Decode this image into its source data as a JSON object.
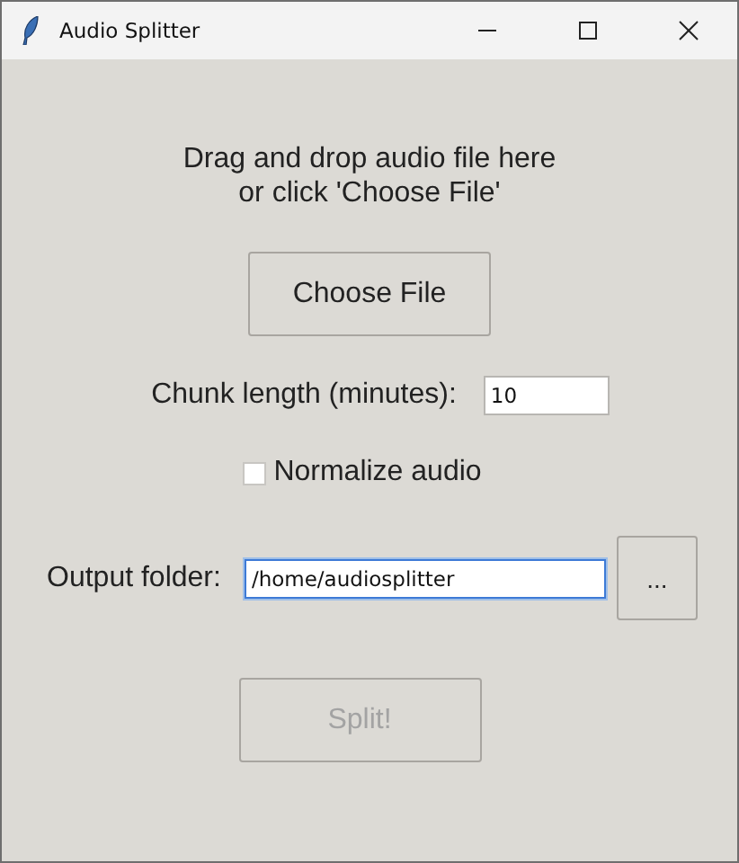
{
  "window": {
    "title": "Audio Splitter"
  },
  "instructions": [
    "Drag and drop audio file here",
    "or click 'Choose File'"
  ],
  "choose_button": {
    "label": "Choose File",
    "disabled": false
  },
  "chunk_length": {
    "label": "Chunk length (minutes):",
    "value": "10"
  },
  "normalize": {
    "label": "Normalize audio",
    "checked": false
  },
  "output_folder": {
    "label": "Output folder:",
    "value": "/home/audiosplitter",
    "focused": true
  },
  "browse_button": {
    "label": "...",
    "disabled": false
  },
  "split_button": {
    "label": "Split!",
    "disabled": true
  }
}
